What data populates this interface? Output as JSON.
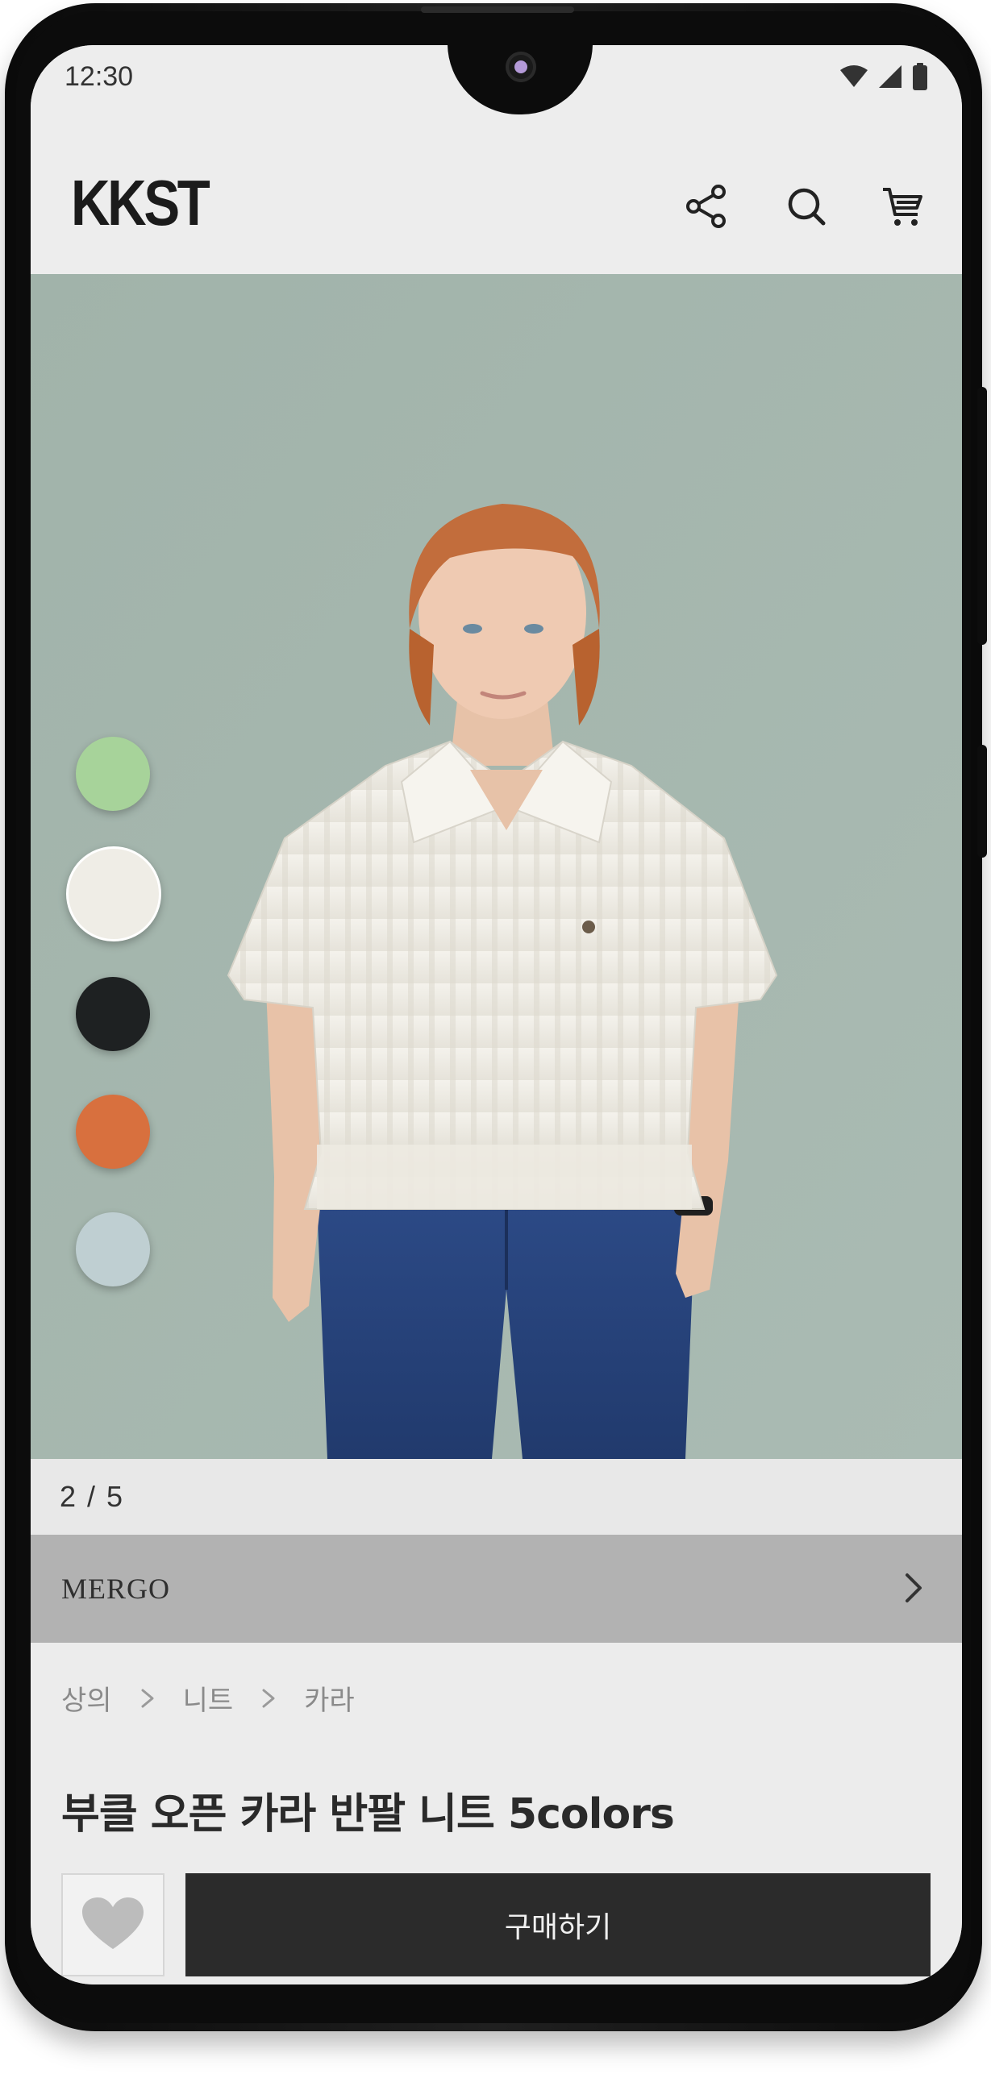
{
  "status_bar": {
    "time": "12:30",
    "icons": [
      "wifi-icon",
      "cell-signal-icon",
      "battery-icon"
    ]
  },
  "header": {
    "logo": "KKST",
    "actions": [
      "share-icon",
      "search-icon",
      "cart-icon"
    ]
  },
  "gallery": {
    "current_page": 2,
    "total_pages": 5,
    "pager_text": "2 / 5",
    "color_swatches": [
      {
        "name": "green",
        "color": "#a7d39a",
        "selected": false
      },
      {
        "name": "white",
        "color": "#efede6",
        "selected": true
      },
      {
        "name": "black",
        "color": "#1e2122",
        "selected": false
      },
      {
        "name": "orange",
        "color": "#d8703e",
        "selected": false
      },
      {
        "name": "light-blue",
        "color": "#bfcfd2",
        "selected": false
      }
    ]
  },
  "brand": {
    "name": "MERGO"
  },
  "breadcrumb": [
    "상의",
    "니트",
    "카라"
  ],
  "product": {
    "title": "부클 오픈 카라 반팔 니트 5colors"
  },
  "actions": {
    "buy_label": "구매하기",
    "like_icon": "heart-icon"
  },
  "colors": {
    "background": "#ececec",
    "hero_background": "#a7b8b0",
    "brand_bar": "#b2b2b2",
    "buy_button": "#2b2b2b"
  }
}
